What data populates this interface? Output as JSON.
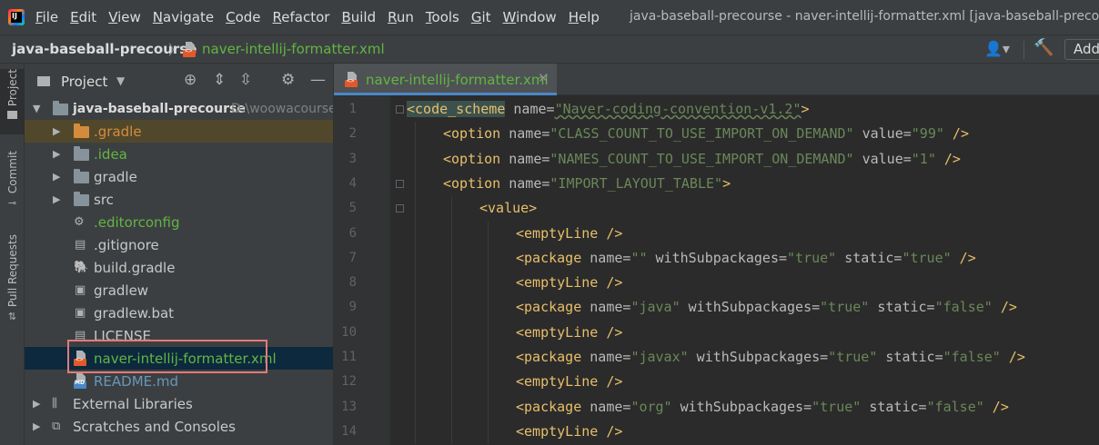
{
  "menubar": {
    "logo": "IJ",
    "items": [
      "File",
      "Edit",
      "View",
      "Navigate",
      "Code",
      "Refactor",
      "Build",
      "Run",
      "Tools",
      "Git",
      "Window",
      "Help"
    ],
    "mnemonics": [
      "F",
      "E",
      "V",
      "N",
      "C",
      "R",
      "B",
      "R",
      "T",
      "G",
      "W",
      "H"
    ],
    "window_title": "java-baseball-precourse - naver-intellij-formatter.xml [java-baseball-precourse]"
  },
  "navbar": {
    "project": "java-baseball-precourse",
    "file": "naver-intellij-formatter.xml",
    "add_label": "Add"
  },
  "left_strip": {
    "tabs": [
      "Project",
      "Commit",
      "Pull Requests"
    ]
  },
  "project_panel": {
    "title": "Project",
    "root": {
      "name": "java-baseball-precourse",
      "path": "D:\\woowacourse"
    },
    "items": [
      {
        "label": ".gradle",
        "kind": "folder-excluded"
      },
      {
        "label": ".idea",
        "kind": "folder-idea"
      },
      {
        "label": "gradle",
        "kind": "folder"
      },
      {
        "label": "src",
        "kind": "folder"
      },
      {
        "label": ".editorconfig",
        "kind": "editorconfig"
      },
      {
        "label": ".gitignore",
        "kind": "file"
      },
      {
        "label": "build.gradle",
        "kind": "gradle"
      },
      {
        "label": "gradlew",
        "kind": "file"
      },
      {
        "label": "gradlew.bat",
        "kind": "file"
      },
      {
        "label": "LICENSE",
        "kind": "file"
      },
      {
        "label": "naver-intellij-formatter.xml",
        "kind": "xml"
      },
      {
        "label": "README.md",
        "kind": "md"
      }
    ],
    "external_libraries": "External Libraries",
    "scratches": "Scratches and Consoles"
  },
  "editor": {
    "tab_label": "naver-intellij-formatter.xml",
    "line_numbers": [
      "1",
      "2",
      "3",
      "4",
      "5",
      "6",
      "7",
      "8",
      "9",
      "10",
      "11",
      "12",
      "13",
      "14"
    ],
    "lines": [
      {
        "tag": "<code_scheme",
        "rest": [
          [
            " name=",
            "a"
          ],
          [
            "\"Naver-coding-convention-v1.2\"",
            "v"
          ],
          [
            ">",
            "p"
          ]
        ]
      },
      {
        "tag": "<option",
        "rest": [
          [
            " name=",
            "a"
          ],
          [
            "\"CLASS_COUNT_TO_USE_IMPORT_ON_DEMAND\"",
            "v"
          ],
          [
            " value=",
            "a"
          ],
          [
            "\"99\"",
            "v"
          ],
          [
            " />",
            "p"
          ]
        ]
      },
      {
        "tag": "<option",
        "rest": [
          [
            " name=",
            "a"
          ],
          [
            "\"NAMES_COUNT_TO_USE_IMPORT_ON_DEMAND\"",
            "v"
          ],
          [
            " value=",
            "a"
          ],
          [
            "\"1\"",
            "v"
          ],
          [
            " />",
            "p"
          ]
        ]
      },
      {
        "tag": "<option",
        "rest": [
          [
            " name=",
            "a"
          ],
          [
            "\"IMPORT_LAYOUT_TABLE\"",
            "v"
          ],
          [
            ">",
            "p"
          ]
        ]
      },
      {
        "tag": "<value>",
        "rest": []
      },
      {
        "tag": "<emptyLine",
        "rest": [
          [
            " />",
            "p"
          ]
        ]
      },
      {
        "tag": "<package",
        "rest": [
          [
            " name=",
            "a"
          ],
          [
            "\"\"",
            "v"
          ],
          [
            " withSubpackages=",
            "a"
          ],
          [
            "\"true\"",
            "v"
          ],
          [
            " static=",
            "a"
          ],
          [
            "\"true\"",
            "v"
          ],
          [
            " />",
            "p"
          ]
        ]
      },
      {
        "tag": "<emptyLine",
        "rest": [
          [
            " />",
            "p"
          ]
        ]
      },
      {
        "tag": "<package",
        "rest": [
          [
            " name=",
            "a"
          ],
          [
            "\"java\"",
            "v"
          ],
          [
            " withSubpackages=",
            "a"
          ],
          [
            "\"true\"",
            "v"
          ],
          [
            " static=",
            "a"
          ],
          [
            "\"false\"",
            "v"
          ],
          [
            " />",
            "p"
          ]
        ]
      },
      {
        "tag": "<emptyLine",
        "rest": [
          [
            " />",
            "p"
          ]
        ]
      },
      {
        "tag": "<package",
        "rest": [
          [
            " name=",
            "a"
          ],
          [
            "\"javax\"",
            "v"
          ],
          [
            " withSubpackages=",
            "a"
          ],
          [
            "\"true\"",
            "v"
          ],
          [
            " static=",
            "a"
          ],
          [
            "\"false\"",
            "v"
          ],
          [
            " />",
            "p"
          ]
        ]
      },
      {
        "tag": "<emptyLine",
        "rest": [
          [
            " />",
            "p"
          ]
        ]
      },
      {
        "tag": "<package",
        "rest": [
          [
            " name=",
            "a"
          ],
          [
            "\"org\"",
            "v"
          ],
          [
            " withSubpackages=",
            "a"
          ],
          [
            "\"true\"",
            "v"
          ],
          [
            " static=",
            "a"
          ],
          [
            "\"false\"",
            "v"
          ],
          [
            " />",
            "p"
          ]
        ]
      },
      {
        "tag": "<emptyLine",
        "rest": [
          [
            " />",
            "p"
          ]
        ]
      }
    ]
  },
  "colors": {
    "accent": "#4a88c7",
    "vcs_added": "#62b543",
    "selection_outline": "#e27b7b"
  }
}
